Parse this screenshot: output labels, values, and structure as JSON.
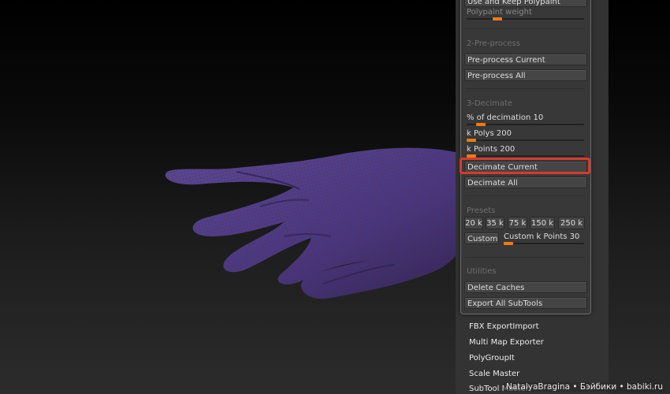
{
  "panel": {
    "top_button": "Use and Keep Polypaint",
    "polypaint_weight": "Polypaint weight",
    "pre_process": {
      "header": "2-Pre-process",
      "current": "Pre-process Current",
      "all": "Pre-process All"
    },
    "decimate": {
      "header": "3-Decimate",
      "pct_label": "% of decimation",
      "pct_value": "10",
      "kpolys_label": "k Polys",
      "kpolys_value": "200",
      "kpoints_label": "k Points",
      "kpoints_value": "200",
      "current": "Decimate Current",
      "all": "Decimate All"
    },
    "presets": {
      "header": "Presets",
      "items": [
        "20 k",
        "35 k",
        "75 k",
        "150 k",
        "250 k"
      ],
      "custom": "Custom",
      "custom_points_label": "Custom k Points",
      "custom_points_value": "30"
    },
    "utilities": {
      "header": "Utilities",
      "delete_caches": "Delete Caches",
      "export_all": "Export All SubTools"
    }
  },
  "plugins": [
    "FBX ExportImport",
    "Multi Map Exporter",
    "PolyGroupIt",
    "Scale Master",
    "SubTool Master"
  ],
  "watermark": "NatalyaBragina • Бэйбики • babiki.ru",
  "colors": {
    "accent_orange": "#f07a13",
    "highlight_red": "#d63a2e",
    "hand_purple": "#4a3a86"
  }
}
